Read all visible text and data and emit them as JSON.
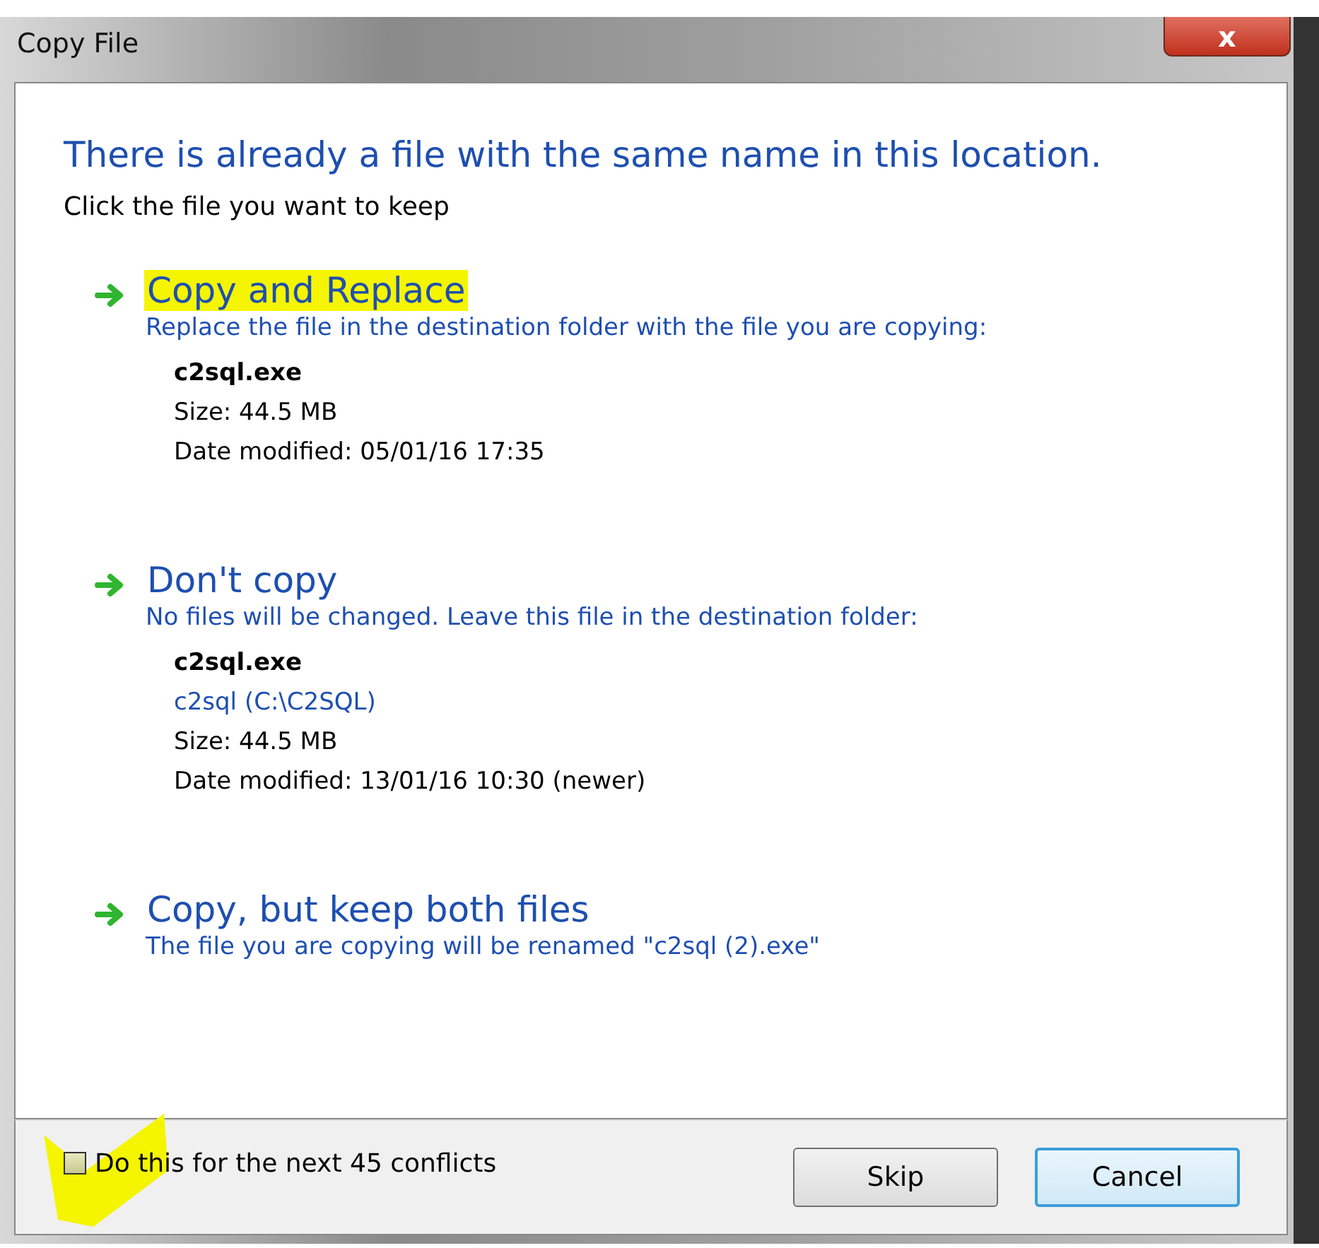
{
  "window": {
    "title": "Copy File",
    "close": "x"
  },
  "heading": "There is already a file with the same name in this location.",
  "subheading": "Click the file you want to keep",
  "options": [
    {
      "title": "Copy and Replace",
      "highlighted": true,
      "description": "Replace the file in the destination folder with the file you are copying:",
      "details": [
        {
          "kind": "name",
          "text": "c2sql.exe"
        },
        {
          "kind": "plain",
          "text": "Size: 44.5 MB"
        },
        {
          "kind": "plain",
          "text": "Date modified: 05/01/16 17:35"
        }
      ]
    },
    {
      "title": "Don't copy",
      "highlighted": false,
      "description": "No files will be changed. Leave this file in the destination folder:",
      "details": [
        {
          "kind": "name",
          "text": "c2sql.exe"
        },
        {
          "kind": "link",
          "text": "c2sql (C:\\C2SQL)"
        },
        {
          "kind": "plain",
          "text": "Size: 44.5 MB"
        },
        {
          "kind": "plain",
          "text": "Date modified: 13/01/16 10:30 (newer)"
        }
      ]
    },
    {
      "title": "Copy, but keep both files",
      "highlighted": false,
      "description": "The file you are copying will be renamed \"c2sql (2).exe\""
    }
  ],
  "checkbox": {
    "label": "Do this for the next 45 conflicts",
    "checked": false,
    "highlighted": true
  },
  "buttons": [
    {
      "label": "Skip",
      "selected": false
    },
    {
      "label": "Cancel",
      "selected": true
    }
  ]
}
